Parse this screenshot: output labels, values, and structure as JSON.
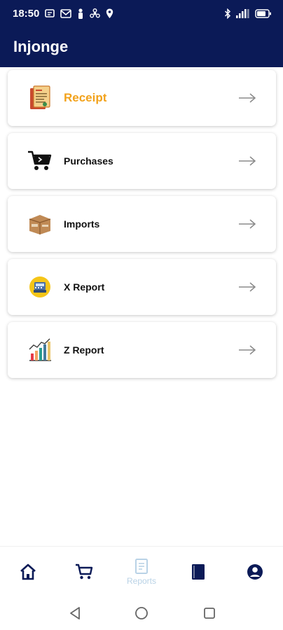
{
  "status_bar": {
    "time": "18:50",
    "left_icons": [
      "notification-icon",
      "gmail-icon",
      "figure-icon",
      "fan-icon",
      "location-icon"
    ],
    "right_icons": [
      "bluetooth-icon",
      "signal-icon",
      "battery-icon"
    ]
  },
  "app_bar": {
    "title": "Injonge"
  },
  "cards": [
    {
      "label": "Receipt",
      "icon": "receipt-icon",
      "highlighted": true
    },
    {
      "label": "Purchases",
      "icon": "cart-icon",
      "highlighted": false
    },
    {
      "label": "Imports",
      "icon": "box-icon",
      "highlighted": false
    },
    {
      "label": "X Report",
      "icon": "register-icon",
      "highlighted": false
    },
    {
      "label": "Z Report",
      "icon": "bar-chart-icon",
      "highlighted": false
    }
  ],
  "bottom_nav": {
    "items": [
      {
        "icon": "home-icon",
        "label": ""
      },
      {
        "icon": "cart-icon",
        "label": ""
      },
      {
        "icon": "receipt-icon",
        "label": "Reports",
        "active": true
      },
      {
        "icon": "book-icon",
        "label": ""
      },
      {
        "icon": "account-icon",
        "label": ""
      }
    ]
  },
  "colors": {
    "primary": "#0b1a57",
    "accent": "#f2a21b",
    "active_nav": "#b9d2e6"
  }
}
